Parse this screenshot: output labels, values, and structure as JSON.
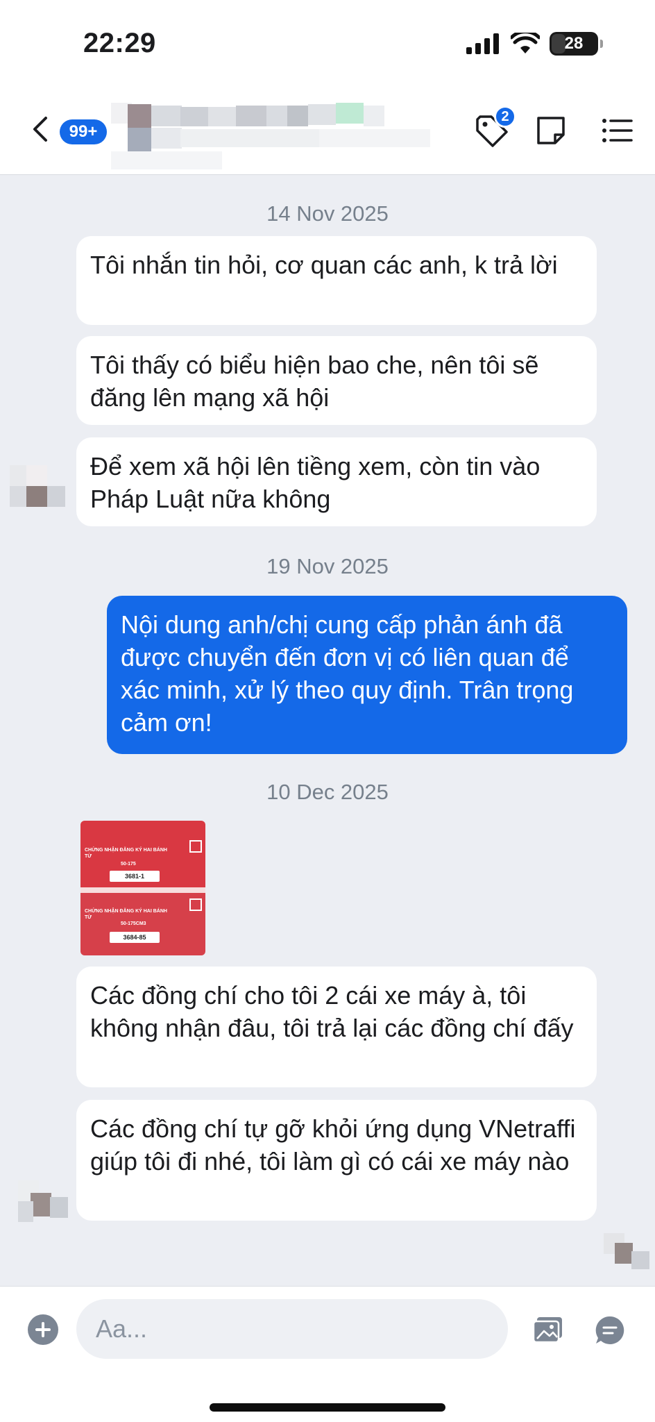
{
  "status_bar": {
    "time": "22:29",
    "battery": "28"
  },
  "header": {
    "unread_badge": "99+",
    "tag_count": "2"
  },
  "messages": [
    {
      "date": "14 Nov 2025"
    },
    {
      "text": "Tôi nhắn tin hỏi, cơ quan các anh, k trả lời"
    },
    {
      "text": "Tôi thấy có biểu hiện bao che, nên tôi sẽ đăng lên mạng xã hội"
    },
    {
      "text": "Để xem xã hội lên tiềng xem, còn tin vào Pháp Luật nữa không"
    },
    {
      "date": "19 Nov 2025"
    },
    {
      "text": "Nội dung anh/chị cung cấp phản ánh đã được chuyển đến đơn vị có liên quan để xác minh, xử lý theo quy định. Trân trọng cảm ơn!"
    },
    {
      "date": "10 Dec 2025"
    },
    {
      "image_cards": [
        {
          "title": "CHỨNG NHẬN ĐĂNG KÝ HAI BÁNH TỪ",
          "code": "50-175",
          "plate": "3681-1"
        },
        {
          "title": "CHỨNG NHẬN ĐĂNG KÝ HAI BÁNH TỪ",
          "code": "50-175CM3",
          "plate": "3684-85"
        }
      ]
    },
    {
      "text": "Các đồng chí cho tôi 2 cái xe máy à, tôi không nhận đâu, tôi trả lại các đồng chí đấy"
    },
    {
      "text": "Các đồng chí tự gỡ khỏi ứng dụng VNetraffi giúp tôi đi nhé, tôi làm gì có cái xe máy nào"
    }
  ],
  "composer": {
    "placeholder": "Aa..."
  },
  "icons": {
    "back": "chevron-left-icon",
    "tag": "tag-icon",
    "note": "note-icon",
    "menu": "list-icon",
    "plus": "plus-icon",
    "gallery": "image-icon",
    "chat": "chat-bubble-icon"
  },
  "colors": {
    "accent": "#1469E8",
    "background": "#ECEEF3",
    "bubble": "#FFFFFF"
  }
}
